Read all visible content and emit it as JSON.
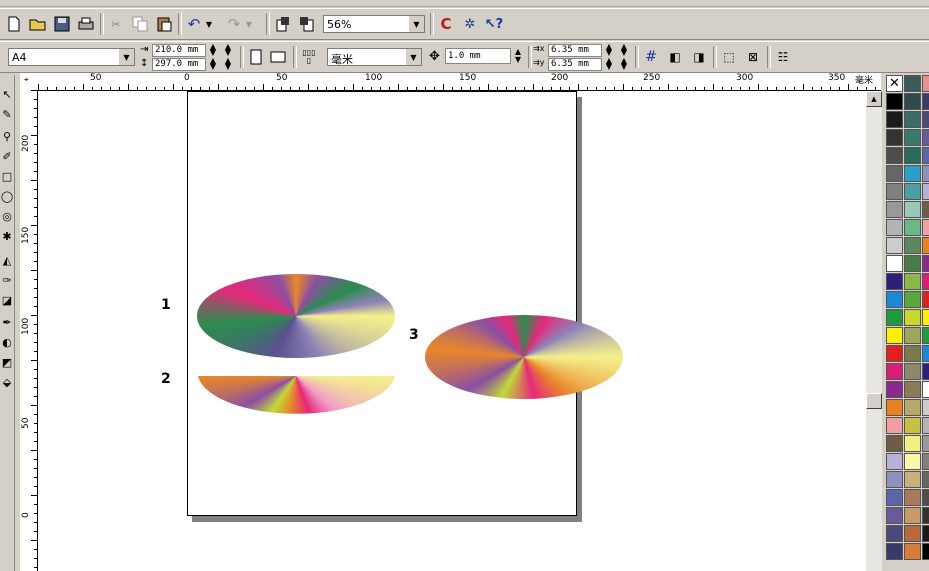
{
  "toolbar": {
    "zoom": "56%",
    "paper_size": "A4",
    "width": "210.0 mm",
    "height": "297.0 mm",
    "units": "毫米",
    "nudge": "1.0 mm",
    "dup_x": "6.35 mm",
    "dup_y": "6.35 mm"
  },
  "ruler": {
    "unit_label": "毫米",
    "h_labels": [
      "50",
      "0",
      "50",
      "100",
      "150",
      "200",
      "250",
      "300",
      "350"
    ],
    "v_labels": [
      "200",
      "150",
      "100",
      "50",
      "0"
    ]
  },
  "labels": {
    "ellipse1": "1",
    "ellipse2": "2",
    "ellipse3": "3"
  },
  "colors": {
    "gradient_stops": [
      "#f5f08a",
      "#8d82b8",
      "#5a4f90",
      "#2b8c4e",
      "#e6287a",
      "#8a4fa3",
      "#e8872a",
      "#c2d93a"
    ],
    "palette_col1": [
      "#000000",
      "#1a1a1a",
      "#333333",
      "#4d4d4d",
      "#666666",
      "#808080",
      "#999999",
      "#b3b3b3",
      "#cccccc",
      "#ffffff",
      "#2e1f7a",
      "#1e88d8",
      "#1f9a3c",
      "#ffef00",
      "#e02020",
      "#d81e78",
      "#8a2a8a",
      "#e8821e",
      "#f0a0a0",
      "#6e5c4a",
      "#b8b0d8",
      "#9090c0",
      "#5a66a8",
      "#6a5a9a",
      "#4a4a7a",
      "#3a3a6a"
    ],
    "palette_col2": [
      "#2e4a4a",
      "#3a6a6a",
      "#3a7a6a",
      "#2a6a5a",
      "#2aa0c8",
      "#4aa0a0",
      "#9ac8b8",
      "#6ab888",
      "#5a8a5a",
      "#4a7a4a",
      "#8ab84a",
      "#5aa83a",
      "#c8d82a",
      "#9aa85a",
      "#7a7a4a",
      "#8a8a6a",
      "#8a7a5a",
      "#b8a86a",
      "#c8c040",
      "#f0f080",
      "#f8f8a8",
      "#c8b078",
      "#a87a5a",
      "#c89a6a",
      "#b8683a",
      "#d87a3a"
    ]
  }
}
